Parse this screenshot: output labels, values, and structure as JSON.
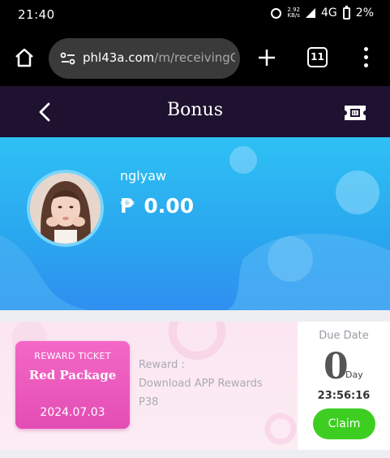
{
  "status_bar": {
    "time": "21:40",
    "data_rate_top": "2.92",
    "data_rate_bottom": "KB/s",
    "network": "4G",
    "battery": "2%",
    "icons": [
      "alarm-icon",
      "signal-icon",
      "battery-icon"
    ]
  },
  "browser": {
    "url_host": "phl43a.com",
    "url_path": "/m/receivingC",
    "tab_count": "11",
    "icons": [
      "home-icon",
      "site-settings-icon",
      "new-tab-icon",
      "tabs-icon",
      "more-menu-icon"
    ]
  },
  "header": {
    "title": "Bonus",
    "icons": [
      "back-arrow-icon",
      "ticket-icon"
    ]
  },
  "profile": {
    "username": "nglyaw",
    "currency_symbol": "₱",
    "balance": "0.00"
  },
  "bonus": {
    "ticket_kicker": "REWARD TICKET",
    "ticket_name": "Red Package",
    "ticket_date": "2024.07.03",
    "reward_label": "Reward :",
    "reward_title": "Download APP Rewards",
    "reward_amount": "P38",
    "due_label": "Due Date",
    "due_days": "0",
    "due_unit": "Day",
    "due_time": "23:56:16",
    "claim_label": "Claim"
  },
  "colors": {
    "header_bg": "#1e1230",
    "banner_blue": "#2aa8ef",
    "ticket_pink": "#e94db8",
    "claim_green": "#3dce21"
  }
}
